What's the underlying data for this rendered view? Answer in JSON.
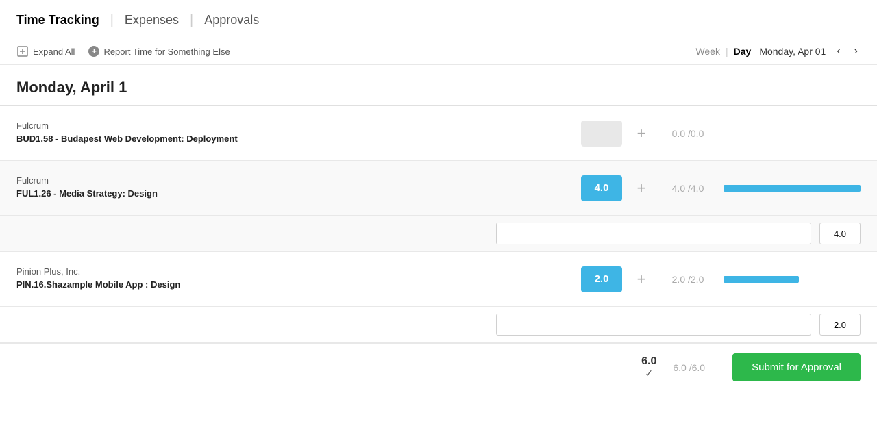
{
  "nav": {
    "items": [
      {
        "label": "Time Tracking",
        "active": true
      },
      {
        "label": "Expenses",
        "active": false
      },
      {
        "label": "Approvals",
        "active": false
      }
    ]
  },
  "toolbar": {
    "expand_all_label": "Expand All",
    "report_time_label": "Report Time for Something Else",
    "view_week_label": "Week",
    "view_day_label": "Day",
    "current_date": "Monday, Apr 01"
  },
  "page": {
    "date_heading": "Monday, April 1"
  },
  "entries": [
    {
      "id": "entry-1",
      "client": "Fulcrum",
      "project": "BUD1.58 - Budapest Web Development: Deployment",
      "hours": "",
      "hours_display": "0.0",
      "hours_max": "0.0",
      "has_value": false,
      "progress_pct": 0,
      "notes_placeholder": "",
      "notes_value": "",
      "hours_input_value": ""
    },
    {
      "id": "entry-2",
      "client": "Fulcrum",
      "project": "FUL1.26 - Media Strategy: Design",
      "hours": "4.0",
      "hours_display": "4.0",
      "hours_max": "4.0",
      "has_value": true,
      "progress_pct": 100,
      "notes_placeholder": "",
      "notes_value": "",
      "hours_input_value": "4.0"
    },
    {
      "id": "entry-3",
      "client": "Pinion Plus, Inc.",
      "project": "PIN.16.Shazample Mobile App : Design",
      "hours": "2.0",
      "hours_display": "2.0",
      "hours_max": "2.0",
      "has_value": true,
      "progress_pct": 55,
      "notes_placeholder": "",
      "notes_value": "",
      "hours_input_value": "2.0"
    }
  ],
  "footer": {
    "total_hours": "6.0",
    "total_hours_display": "6.0",
    "total_hours_max": "6.0",
    "submit_label": "Submit for Approval"
  },
  "icons": {
    "expand": "▾",
    "add_circle": "+",
    "plus": "+",
    "prev_arrow": "‹",
    "next_arrow": "›",
    "checkmark": "✓"
  }
}
